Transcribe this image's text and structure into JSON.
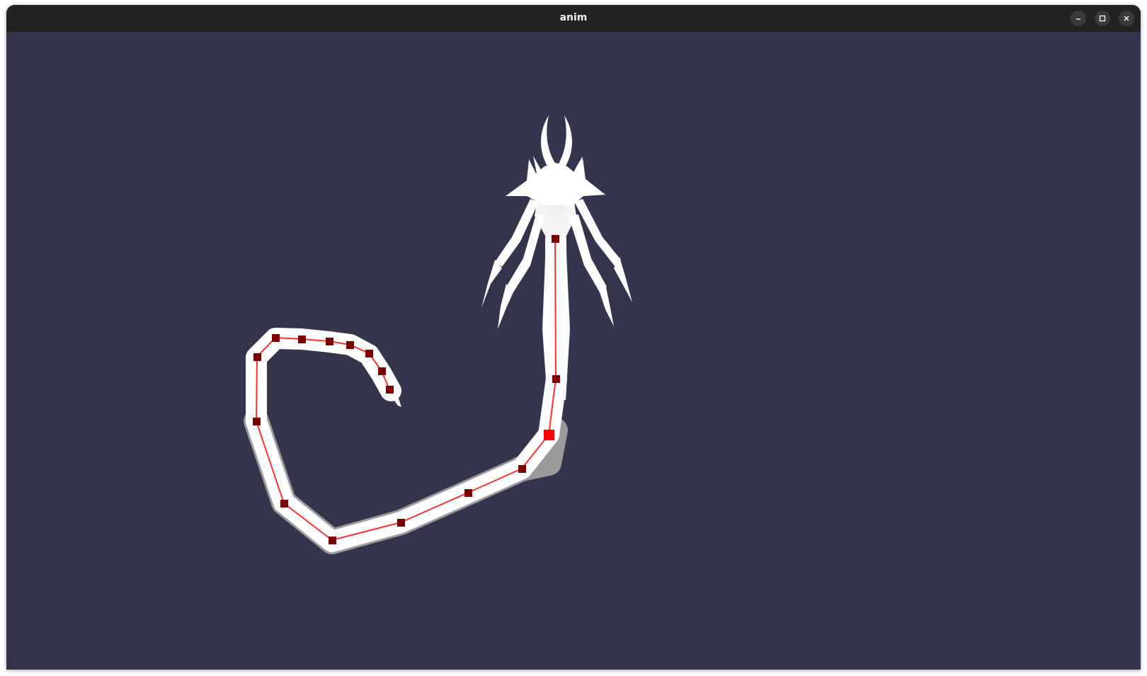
{
  "window": {
    "title": "anim",
    "controls": [
      {
        "name": "minimize",
        "icon": "minimize-icon"
      },
      {
        "name": "maximize",
        "icon": "maximize-icon"
      },
      {
        "name": "close",
        "icon": "close-icon"
      }
    ]
  },
  "viewport": {
    "background_color": "#34344d",
    "model_color": "#ffffff",
    "bone_line_color": "#ff3030",
    "joint_color": "#7a0000",
    "selected_joint_color": "#ff0000"
  }
}
